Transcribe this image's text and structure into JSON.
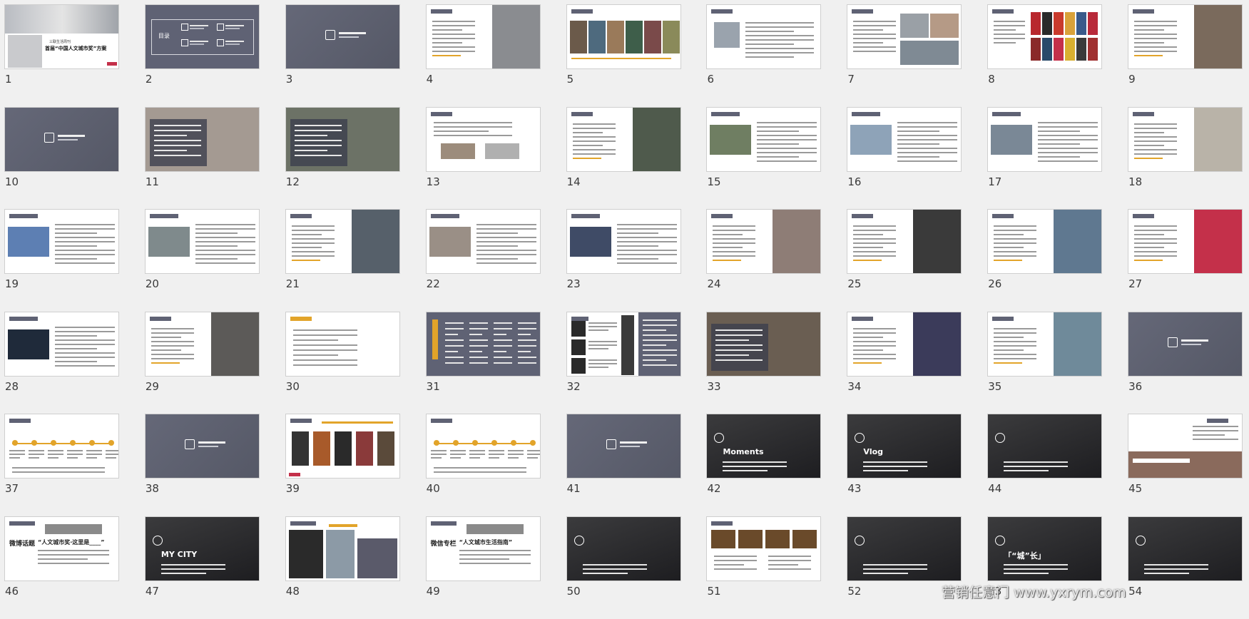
{
  "slides": [
    {
      "n": "1",
      "kind": "title",
      "t1": "三联生活周刊",
      "t2": "首届“中国人文城市奖”方案"
    },
    {
      "n": "2",
      "kind": "toc",
      "label": "目录"
    },
    {
      "n": "3",
      "kind": "section"
    },
    {
      "n": "4",
      "kind": "text-img-right",
      "img": "#8a8c90"
    },
    {
      "n": "5",
      "kind": "img-strip",
      "img": "#6b5a4a"
    },
    {
      "n": "6",
      "kind": "text-small-img"
    },
    {
      "n": "7",
      "kind": "text-img-mid"
    },
    {
      "n": "8",
      "kind": "magazines"
    },
    {
      "n": "9",
      "kind": "text-img-right",
      "img": "#7a6a5c"
    },
    {
      "n": "10",
      "kind": "section"
    },
    {
      "n": "11",
      "kind": "photo-dark",
      "img": "#a49a92"
    },
    {
      "n": "12",
      "kind": "photo-dark",
      "img": "#6c7266"
    },
    {
      "n": "13",
      "kind": "text-two-img"
    },
    {
      "n": "14",
      "kind": "text-img-right",
      "img": "#4f5a4c"
    },
    {
      "n": "15",
      "kind": "img-left-text",
      "img": "#6f7e62"
    },
    {
      "n": "16",
      "kind": "img-left-text",
      "img": "#8ea3b8"
    },
    {
      "n": "17",
      "kind": "img-left-text",
      "img": "#7a8896"
    },
    {
      "n": "18",
      "kind": "text-img-right",
      "img": "#b9b3a8"
    },
    {
      "n": "19",
      "kind": "img-left-text",
      "img": "#5d7fb3"
    },
    {
      "n": "20",
      "kind": "img-left-text",
      "img": "#7f8a8c"
    },
    {
      "n": "21",
      "kind": "text-img-right",
      "img": "#56606a"
    },
    {
      "n": "22",
      "kind": "img-left-text",
      "img": "#9a8f86"
    },
    {
      "n": "23",
      "kind": "img-left-text",
      "img": "#3f4b66"
    },
    {
      "n": "24",
      "kind": "text-img-right",
      "img": "#8e7d76"
    },
    {
      "n": "25",
      "kind": "text-img-right",
      "img": "#3a3a3a"
    },
    {
      "n": "26",
      "kind": "text-img-right",
      "img": "#5f7890"
    },
    {
      "n": "27",
      "kind": "text-img-right",
      "img": "#c4304a"
    },
    {
      "n": "28",
      "kind": "img-left-text",
      "img": "#1f2a3a"
    },
    {
      "n": "29",
      "kind": "text-img-right",
      "img": "#5c5a58"
    },
    {
      "n": "30",
      "kind": "text-only"
    },
    {
      "n": "31",
      "kind": "dark-list"
    },
    {
      "n": "32",
      "kind": "portraits"
    },
    {
      "n": "33",
      "kind": "photo-dark",
      "img": "#6a5e52"
    },
    {
      "n": "34",
      "kind": "text-img-right",
      "img": "#3b3b5a"
    },
    {
      "n": "35",
      "kind": "text-img-right",
      "img": "#6f8a9a"
    },
    {
      "n": "36",
      "kind": "section"
    },
    {
      "n": "37",
      "kind": "timeline"
    },
    {
      "n": "38",
      "kind": "section"
    },
    {
      "n": "39",
      "kind": "phones"
    },
    {
      "n": "40",
      "kind": "timeline"
    },
    {
      "n": "41",
      "kind": "section"
    },
    {
      "n": "42",
      "kind": "dark-feature",
      "label": "Moments"
    },
    {
      "n": "43",
      "kind": "dark-feature",
      "label": "Vlog"
    },
    {
      "n": "44",
      "kind": "dark-feature",
      "label": ""
    },
    {
      "n": "45",
      "kind": "text-img-bottom",
      "img": "#8a6a5c"
    },
    {
      "n": "46",
      "kind": "weibo",
      "label": "微博话题",
      "sub": "“人文城市奖·这里是____”"
    },
    {
      "n": "47",
      "kind": "dark-feature",
      "label": "MY CITY"
    },
    {
      "n": "48",
      "kind": "img-grid"
    },
    {
      "n": "49",
      "kind": "weibo",
      "label": "微信专栏",
      "sub": "“人文城市生活指南”"
    },
    {
      "n": "50",
      "kind": "dark-feature",
      "label": ""
    },
    {
      "n": "51",
      "kind": "photo-strip"
    },
    {
      "n": "52",
      "kind": "dark-feature",
      "label": ""
    },
    {
      "n": "53",
      "kind": "dark-feature",
      "label": "「“城”长」"
    },
    {
      "n": "54",
      "kind": "dark-feature",
      "label": ""
    }
  ],
  "watermark": "营销任意门 www.yxrym.com",
  "colors": {
    "accent": "#5f6274",
    "highlight": "#e2a42a",
    "brand_red": "#c4304a"
  }
}
